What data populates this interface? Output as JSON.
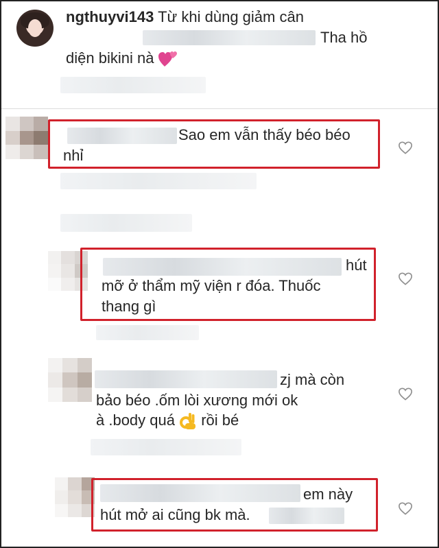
{
  "post": {
    "username": "ngthuyvi143",
    "caption_line1": "Từ khi dùng giảm cân",
    "caption_line1_end": "Tha hồ",
    "caption_line2": "diện bikini nà",
    "caption_emoji": "two-hearts-emoji"
  },
  "comments": [
    {
      "line1": "Sao em vẫn thấy béo béo",
      "line2": "nhỉ",
      "highlighted": true,
      "liked": false
    },
    {
      "line1": "hút",
      "line2": "mỡ ở thẩm mỹ viện r đóa. Thuốc",
      "line3": "thang gì",
      "highlighted": true,
      "liked": false
    },
    {
      "line1": "zj mà còn",
      "line2": "bảo béo .ốm lòi xương mới ok",
      "line3_a": "à .body quá",
      "line3_b": "rồi bé",
      "emoji": "ok-hand-emoji",
      "highlighted": false,
      "liked": false
    },
    {
      "line1": "em này",
      "line2": "hút mở ai cũng bk mà.",
      "highlighted": true,
      "liked": false
    }
  ],
  "colors": {
    "highlight_border": "#d1212b",
    "text": "#262626",
    "heart_outline": "#8e8e8e",
    "emoji_heart": "#e0448f",
    "emoji_ok": "#f5b921"
  },
  "icons": [
    "heart-outline-icon",
    "two-hearts-emoji",
    "ok-hand-emoji"
  ]
}
